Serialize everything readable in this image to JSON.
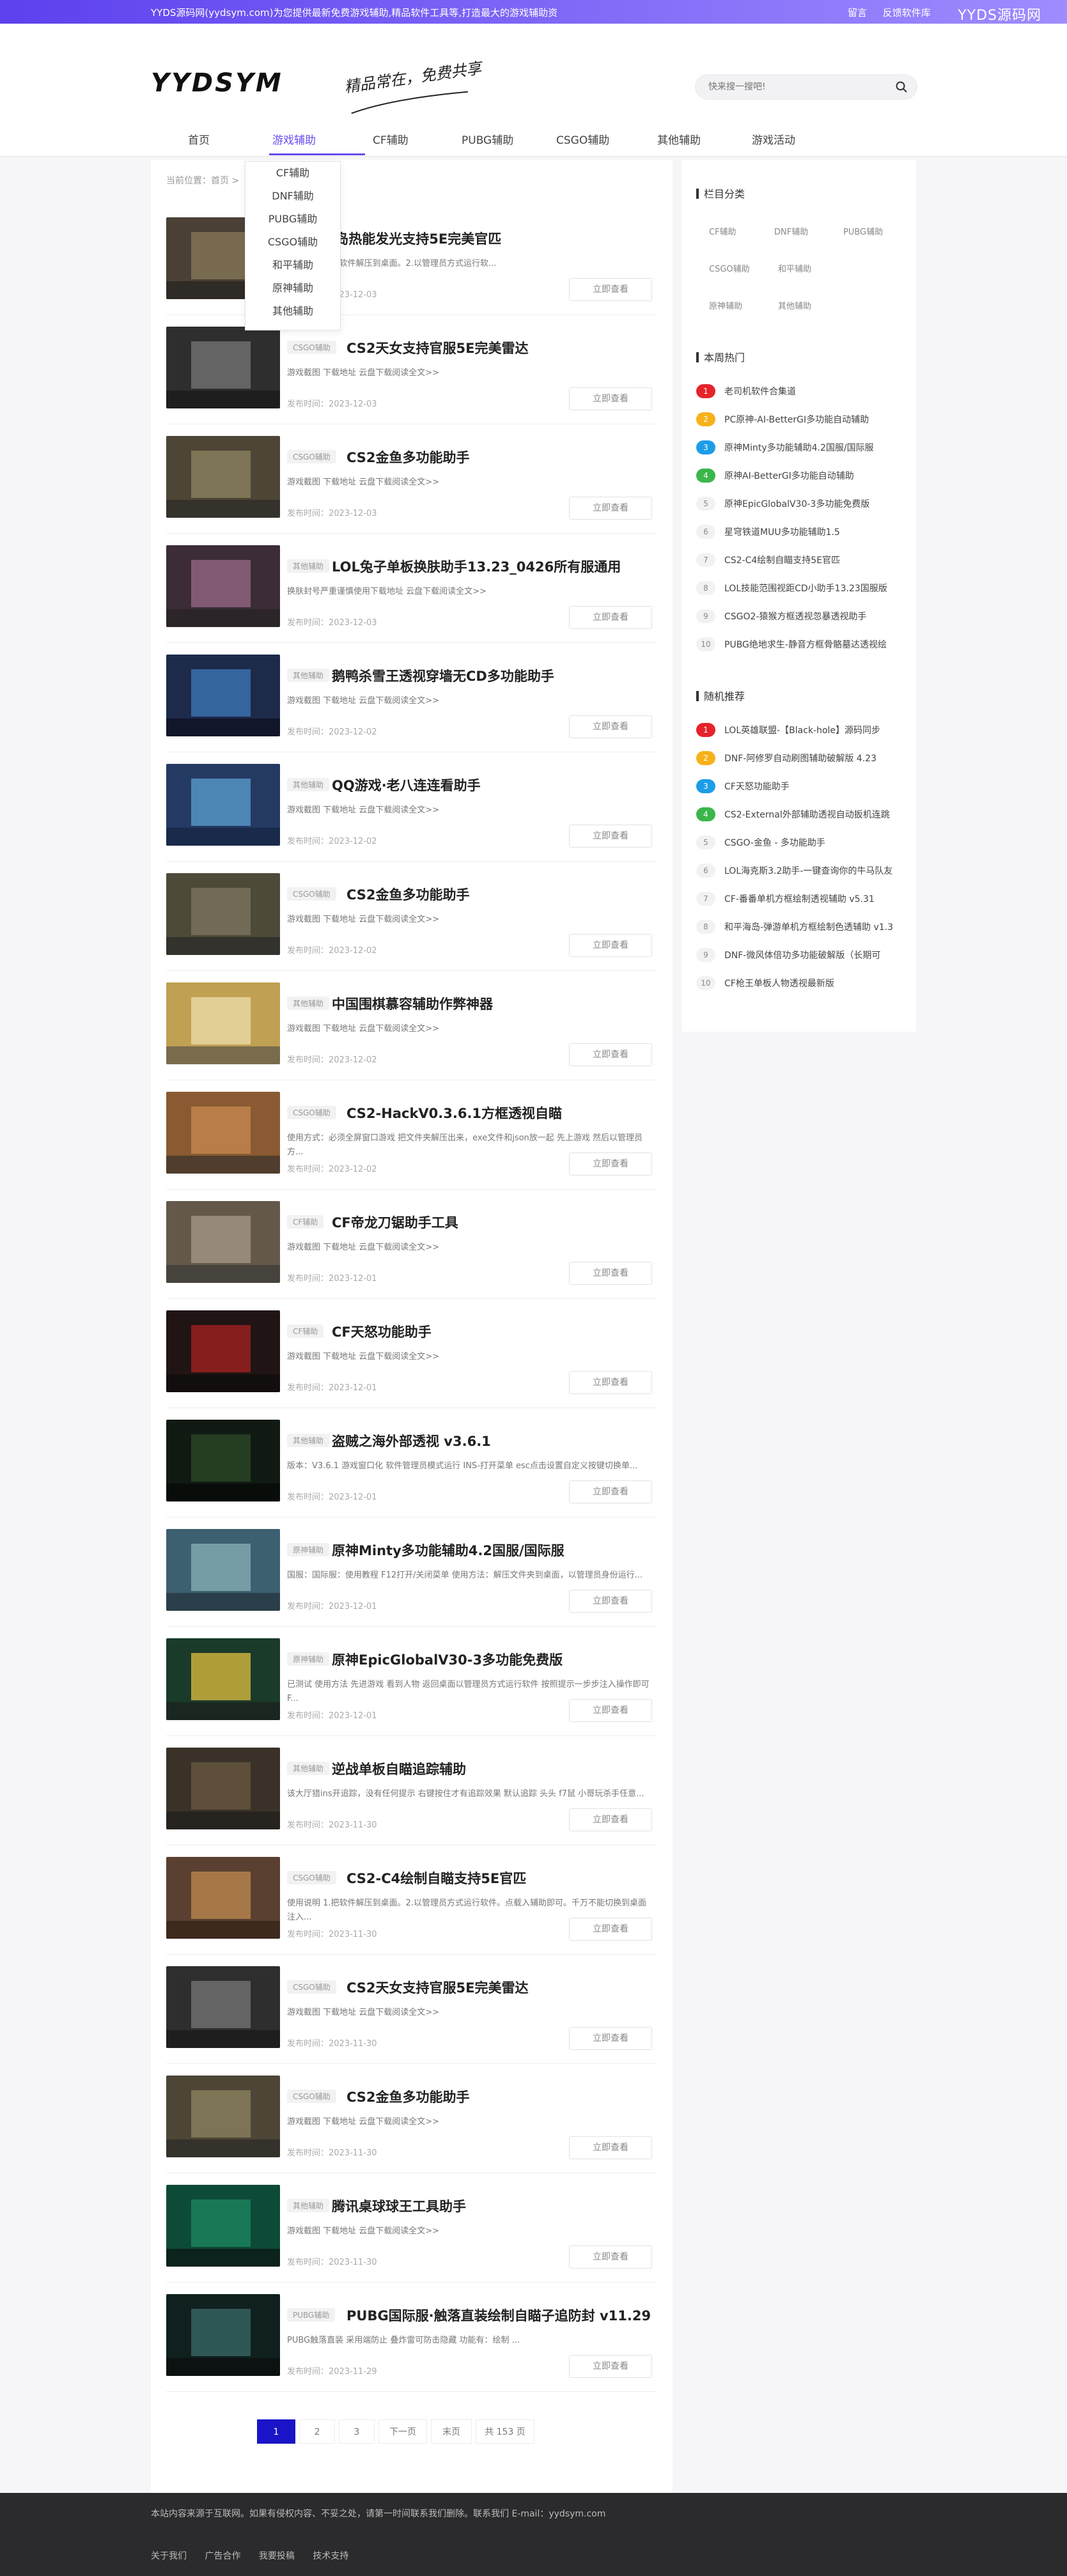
{
  "topbar": {
    "notice": "YYDS源码网(yydsym.com)为您提供最新免费游戏辅助,精品软件工具等,打造最大的游戏辅助资",
    "links": [
      "留言",
      "反馈软件库"
    ],
    "brand": "YYDS源码网"
  },
  "header": {
    "logo": "YYDSYM",
    "slogan": "精品常在，免费共享",
    "search_placeholder": "快来搜一搜吧!"
  },
  "nav": {
    "items": [
      "首页",
      "游戏辅助",
      "CF辅助",
      "PUBG辅助",
      "CSGO辅助",
      "其他辅助",
      "游戏活动"
    ],
    "active": "游戏辅助",
    "dropdown": [
      "CF辅助",
      "DNF辅助",
      "PUBG辅助",
      "CSGO辅助",
      "和平辅助",
      "原神辅助",
      "其他辅助"
    ]
  },
  "breadcrumb": "当前位置：首页 >",
  "read_more": "立即查看",
  "date_prefix": "发布时间：",
  "articles": [
    {
      "cat": "",
      "title": "CS2-神岛热能发光支持5E完美官匹",
      "excerpt": "使用说明 1.把软件解压到桌面。2.以管理员方式运行软...",
      "date": "2023-12-03"
    },
    {
      "cat": "CSGO辅助",
      "title": "CS2天女支持官服5E完美雷达",
      "excerpt": "游戏截图 下载地址 云盘下载阅读全文>>",
      "date": "2023-12-03"
    },
    {
      "cat": "CSGO辅助",
      "title": "CS2金鱼多功能助手",
      "excerpt": "游戏截图 下载地址 云盘下载阅读全文>>",
      "date": "2023-12-03"
    },
    {
      "cat": "其他辅助",
      "title": "LOL兔子单板换肤助手13.23_0426所有服通用",
      "excerpt": "换肤封号严重谨慎使用下载地址 云盘下载阅读全文>>",
      "date": "2023-12-03"
    },
    {
      "cat": "其他辅助",
      "title": "鹅鸭杀雪王透视穿墙无CD多功能助手",
      "excerpt": "游戏截图 下载地址 云盘下载阅读全文>>",
      "date": "2023-12-02"
    },
    {
      "cat": "其他辅助",
      "title": "QQ游戏·老八连连看助手",
      "excerpt": "游戏截图 下载地址 云盘下载阅读全文>>",
      "date": "2023-12-02"
    },
    {
      "cat": "CSGO辅助",
      "title": "CS2金鱼多功能助手",
      "excerpt": "游戏截图 下载地址 云盘下载阅读全文>>",
      "date": "2023-12-02"
    },
    {
      "cat": "其他辅助",
      "title": "中国围棋慕容辅助作弊神器",
      "excerpt": "游戏截图 下载地址 云盘下载阅读全文>>",
      "date": "2023-12-02"
    },
    {
      "cat": "CSGO辅助",
      "title": "CS2-HackV0.3.6.1方框透视自瞄",
      "excerpt": "使用方式：必须全屏窗口游戏 把文件夹解压出来，exe文件和json放一起 先上游戏 然后以管理员方...",
      "date": "2023-12-02"
    },
    {
      "cat": "CF辅助",
      "title": "CF帝龙刀锯助手工具",
      "excerpt": "游戏截图 下载地址 云盘下载阅读全文>>",
      "date": "2023-12-01"
    },
    {
      "cat": "CF辅助",
      "title": "CF天怒功能助手",
      "excerpt": "游戏截图 下载地址 云盘下载阅读全文>>",
      "date": "2023-12-01"
    },
    {
      "cat": "其他辅助",
      "title": "盗贼之海外部透视 v3.6.1",
      "excerpt": "版本：V3.6.1 游戏窗口化 软件管理员模式运行 INS-打开菜单 esc点击设置自定义按键切换单...",
      "date": "2023-12-01"
    },
    {
      "cat": "原神辅助",
      "title": "原神Minty多功能辅助4.2国服/国际服",
      "excerpt": "国服：国际服：使用教程 F12打开/关闭菜单 使用方法：解压文件夹到桌面，以管理员身份运行...",
      "date": "2023-12-01"
    },
    {
      "cat": "原神辅助",
      "title": "原神EpicGlobalV30-3多功能免费版",
      "excerpt": "已测试 使用方法 先进游戏 看到人物 返回桌面以管理员方式运行软件 按照提示一步步注入操作即可 F...",
      "date": "2023-12-01"
    },
    {
      "cat": "其他辅助",
      "title": "逆战单板自瞄追踪辅助",
      "excerpt": "该大厅猎ins开追踪，没有任何提示 右键按住才有追踪效果 默认追踪 头头 f7鼠 小哥玩杀手任意...",
      "date": "2023-11-30"
    },
    {
      "cat": "CSGO辅助",
      "title": "CS2-C4绘制自瞄支持5E官匹",
      "excerpt": "使用说明 1.把软件解压到桌面。2.以管理员方式运行软件。点载入辅助即可。千万不能切换到桌面注入...",
      "date": "2023-11-30"
    },
    {
      "cat": "CSGO辅助",
      "title": "CS2天女支持官服5E完美雷达",
      "excerpt": "游戏截图 下载地址 云盘下载阅读全文>>",
      "date": "2023-11-30"
    },
    {
      "cat": "CSGO辅助",
      "title": "CS2金鱼多功能助手",
      "excerpt": "游戏截图 下载地址 云盘下载阅读全文>>",
      "date": "2023-11-30"
    },
    {
      "cat": "其他辅助",
      "title": "腾讯桌球球王工具助手",
      "excerpt": "游戏截图 下载地址 云盘下载阅读全文>>",
      "date": "2023-11-30"
    },
    {
      "cat": "PUBG辅助",
      "title": "PUBG国际服·触落直装绘制自瞄子追防封 v11.29",
      "excerpt": "PUBG触落直装 采用端防止 叠炸雷可防击隐藏 功能有：绘制 ...",
      "date": "2023-11-29"
    }
  ],
  "thumb_colors": [
    [
      "#4a4035",
      "#8a7a5a",
      "#1e1e1e"
    ],
    [
      "#2e2e2e",
      "#777777",
      "#141414"
    ],
    [
      "#4d4536",
      "#8e8460",
      "#262626"
    ],
    [
      "#3b2c38",
      "#9a6a86",
      "#222222"
    ],
    [
      "#1d2a4a",
      "#3c7ab8",
      "#0a0a18"
    ],
    [
      "#243a63",
      "#5aa0d0",
      "#14203a"
    ],
    [
      "#4e4a3a",
      "#7c7560",
      "#232323"
    ],
    [
      "#c0a052",
      "#eedfb0",
      "#4a4a4a"
    ],
    [
      "#8a5a32",
      "#c78a50",
      "#2a2a2a"
    ],
    [
      "#63584a",
      "#a8998a",
      "#333333"
    ],
    [
      "#211414",
      "#a82020",
      "#0a0a0a"
    ],
    [
      "#101a12",
      "#2c4a2a",
      "#050505"
    ],
    [
      "#3c6070",
      "#8ab0b8",
      "#1e2a30"
    ],
    [
      "#1a3a2a",
      "#e0c040",
      "#1a1a1a"
    ],
    [
      "#3a3228",
      "#6a5a40",
      "#1a1a1a"
    ],
    [
      "#5a4030",
      "#c08a50",
      "#2a1a10"
    ],
    [
      "#2e2e2e",
      "#777777",
      "#141414"
    ],
    [
      "#4d4536",
      "#8e8460",
      "#262626"
    ],
    [
      "#0e4a38",
      "#1e8a60",
      "#0a0a0a"
    ],
    [
      "#10201e",
      "#3a6a6a",
      "#0a0a0a"
    ]
  ],
  "pagination": {
    "pages": [
      "1",
      "2",
      "3"
    ],
    "current": "1",
    "next": "下一页",
    "last": "末页",
    "total": "共 153 页"
  },
  "sidebar": {
    "category_title": "栏目分类",
    "categories": [
      "CF辅助",
      "DNF辅助",
      "PUBG辅助",
      "CSGO辅助",
      "和平辅助",
      "原神辅助",
      "其他辅助"
    ],
    "hot_title": "本周热门",
    "hot": [
      "老司机软件合集道",
      "PC原神-AI-BetterGI多功能自动辅助",
      "原神Minty多功能辅助4.2国服/国际服",
      "原神AI-BetterGI多功能自动辅助",
      "原神EpicGlobalV30-3多功能免费版",
      "星穹铁道MUU多功能辅助1.5",
      "CS2-C4绘制自瞄支持5E官匹",
      "LOL技能范围视距CD小助手13.23国服版",
      "CSGO2-猿猴方框透视忽暴透视助手",
      "PUBG绝地求生-静音方框骨骼墓达透视绘"
    ],
    "random_title": "随机推荐",
    "random": [
      "LOL英雄联盟-【Black-hole】源码同步",
      "DNF-阿修罗自动刷图辅助破解版 4.23",
      "CF天怒功能助手",
      "CS2-External外部辅助透视自动扳机连跳",
      "CSGO-金鱼 - 多功能助手",
      "LOL海克斯3.2助手-一键查询你的牛马队友",
      "CF-番番单机方框绘制透视辅助 v5.31",
      "和平海岛-弹游单机方框绘制色透辅助 v1.3",
      "DNF-微风体倍功多功能破解版（长期可",
      "CF枪王单板人物透视最新版"
    ]
  },
  "footer": {
    "line1": "本站内容来源于互联网。如果有侵权内容、不妥之处，请第一时间联系我们删除。联系我们 E-mail：yydsym.com",
    "links": [
      "关于我们",
      "广告合作",
      "我要投稿",
      "技术支持"
    ]
  }
}
